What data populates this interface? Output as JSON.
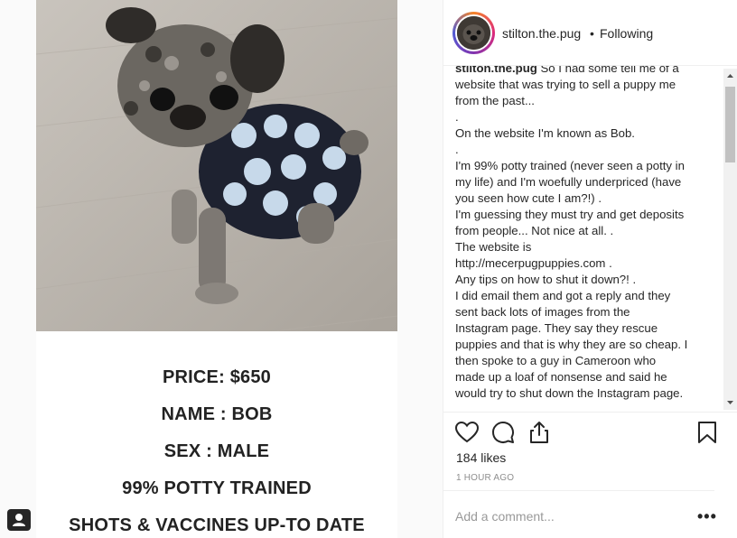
{
  "post": {
    "ad_lines": [
      "PRICE: $650",
      "NAME : BOB",
      "SEX : MALE",
      "99% POTTY TRAINED",
      "SHOTS & VACCINES UP-TO DATE"
    ]
  },
  "header": {
    "username": "stilton.the.pug",
    "separator": "•",
    "follow_status": "Following"
  },
  "caption": {
    "author": "stilton.the.pug",
    "first_line_rest": " So I had some tell me of a",
    "lines": [
      "website that was trying to sell a puppy me",
      "from the past...",
      ".",
      "On the website I'm known as Bob.",
      ".",
      "I'm 99% potty trained (never seen a potty in",
      "my life) and I'm woefully underpriced (have",
      "you seen how cute I am?!) .",
      "I'm guessing they must try and get deposits",
      "from people... Not nice at all. .",
      "The website is",
      "http://mecerpugpuppies.com .",
      "Any tips on how to shut it down?! .",
      "I did email them and got a reply and they",
      "sent back lots of images from the",
      "Instagram page. They say they rescue",
      "puppies and that is why they are so cheap. I",
      "then spoke to a guy in Cameroon who",
      "made up a loaf of nonsense and said he",
      "would try to shut down the Instagram page."
    ]
  },
  "engagement": {
    "likes": "184 likes",
    "timestamp": "1 HOUR AGO"
  },
  "comment": {
    "placeholder": "Add a comment...",
    "more": "•••"
  },
  "icons": {
    "like": "heart-icon",
    "comment": "comment-icon",
    "share": "share-icon",
    "save": "bookmark-icon",
    "report": "report-icon"
  }
}
